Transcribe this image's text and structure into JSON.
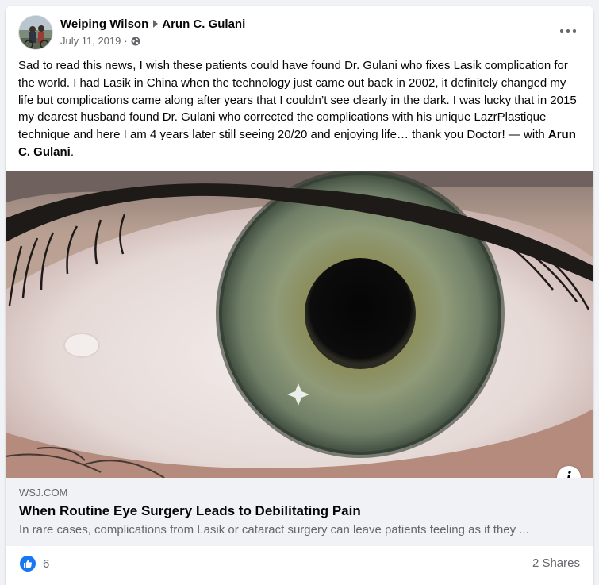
{
  "post": {
    "author": "Weiping Wilson",
    "target": "Arun C. Gulani",
    "date": "July 11, 2019",
    "separator": "·",
    "privacy_icon": "globe-icon",
    "more_icon": "more-options-icon",
    "text_main": "Sad to read this news, I wish these patients could have found Dr. Gulani who fixes Lasik complication for the world. I had Lasik in China when the technology just came out back in 2002, it definitely changed my life but complications came along after years that I couldn’t see clearly in the dark. I was lucky that in 2015 my dearest husband found Dr. Gulani who corrected the complications with his unique LazrPlastique technique and here I am 4 years later still seeing 20/20 and enjoying life… thank you Doctor! — with ",
    "text_tag": "Arun C. Gulani",
    "text_end": "."
  },
  "link": {
    "domain": "WSJ.COM",
    "title": "When Routine Eye Surgery Leads to Debilitating Pain",
    "description": "In rare cases, complications from Lasik or cataract surgery can leave patients feeling as if they ...",
    "info_icon": "info-icon",
    "info_label": "i"
  },
  "footer": {
    "reaction_icon": "like-icon",
    "reaction_count": "6",
    "shares": "2 Shares"
  },
  "colors": {
    "accent": "#1877f2",
    "secondary_text": "#65676b",
    "link_background": "#f0f2f5"
  }
}
